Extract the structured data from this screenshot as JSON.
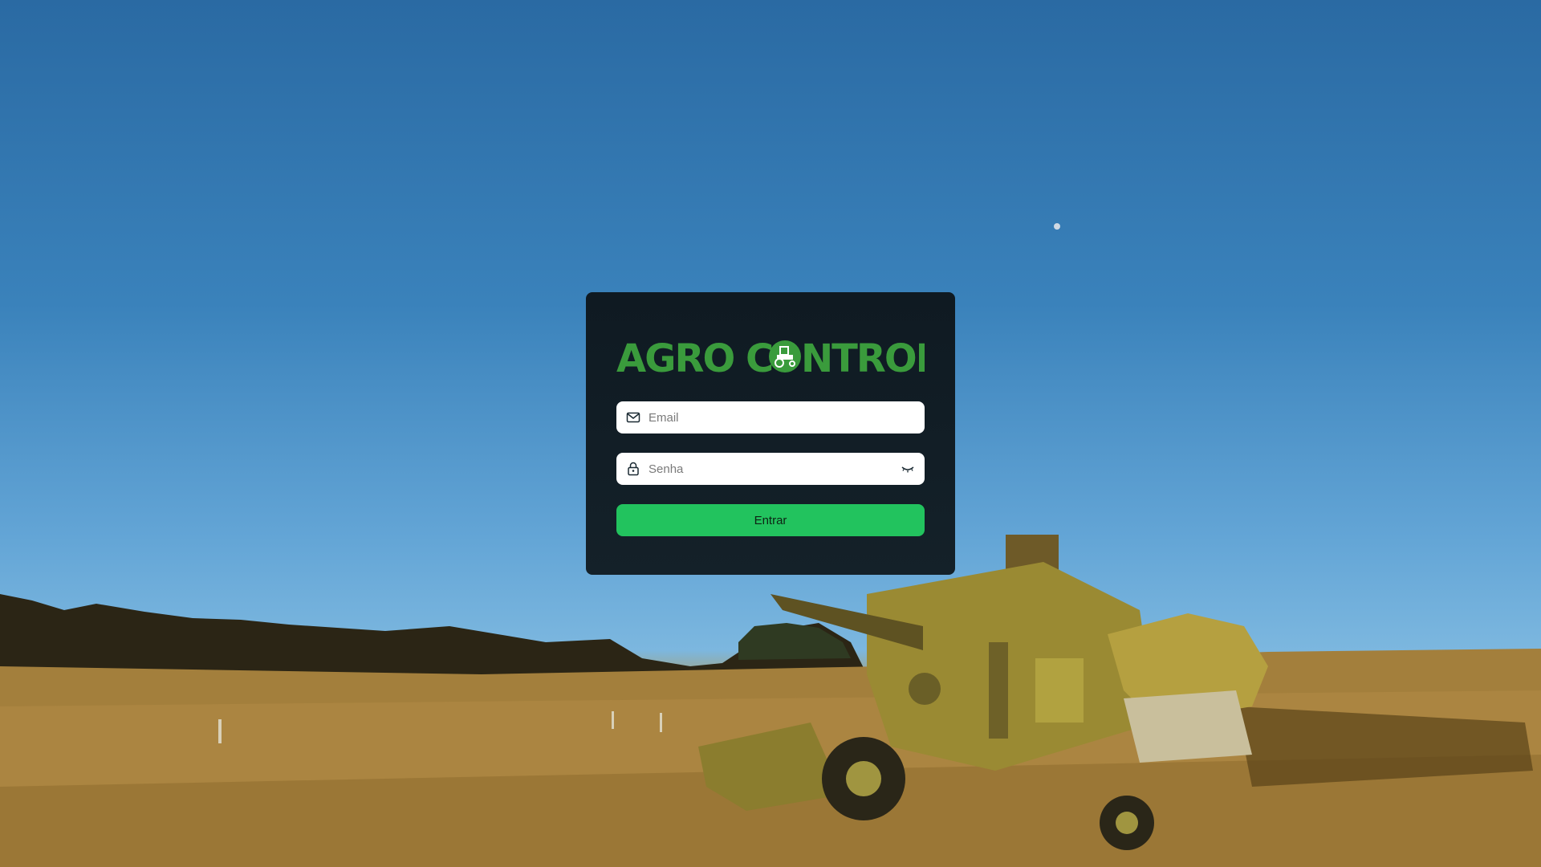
{
  "brand": {
    "logo_text_left": "AGRO C",
    "logo_text_right": "NTROL",
    "logo_icon": "tractor-icon",
    "logo_color": "#3a9b3c"
  },
  "form": {
    "email": {
      "placeholder": "Email",
      "value": "",
      "icon": "mail-icon"
    },
    "password": {
      "placeholder": "Senha",
      "value": "",
      "icon": "lock-icon",
      "toggle_icon": "eye-closed-icon"
    },
    "submit_label": "Entrar",
    "submit_color": "#22c35e"
  },
  "background": {
    "image": "wheat-field-combine-harvester"
  }
}
